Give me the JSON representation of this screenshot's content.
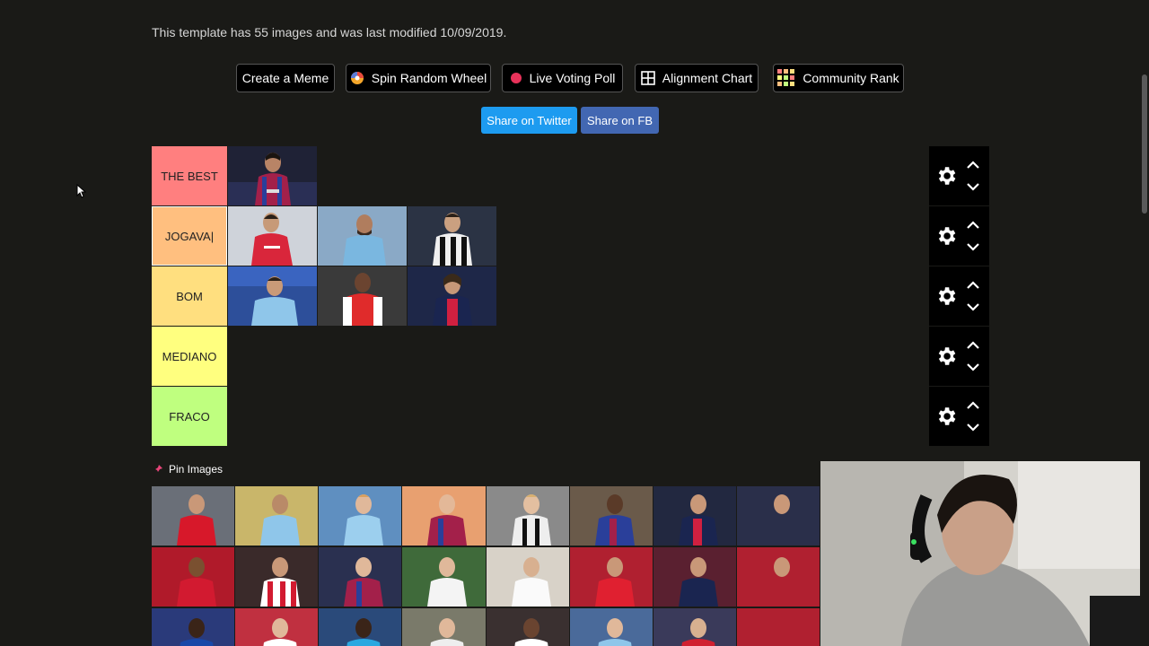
{
  "page": {
    "info_text": "This template has 55 images and was last modified 10/09/2019."
  },
  "buttons": [
    {
      "label": "Create a Meme",
      "icon": "none"
    },
    {
      "label": "Spin Random Wheel",
      "icon": "wheel-icon"
    },
    {
      "label": "Live Voting Poll",
      "icon": "record-dot-icon"
    },
    {
      "label": "Alignment Chart",
      "icon": "grid-icon"
    },
    {
      "label": "Community Rank",
      "icon": "color-grid-icon"
    }
  ],
  "share": {
    "twitter": "Share on Twitter",
    "facebook": "Share on FB",
    "twitter_color": "#1d9bf0",
    "facebook_color": "#4267b2"
  },
  "tiers": [
    {
      "label": "THE BEST",
      "color": "#ff7f7f"
    },
    {
      "label": "JOGAVA|",
      "color": "#ffbf7f"
    },
    {
      "label": "BOM",
      "color": "#ffdf7f"
    },
    {
      "label": "MEDIANO",
      "color": "#ffff7f"
    },
    {
      "label": "FRACO",
      "color": "#bfff7f"
    }
  ],
  "pin_images_label": "Pin Images",
  "colors": {
    "background": "#1a1a17",
    "control_bg": "#000000",
    "pin_icon": "#e8457a"
  }
}
